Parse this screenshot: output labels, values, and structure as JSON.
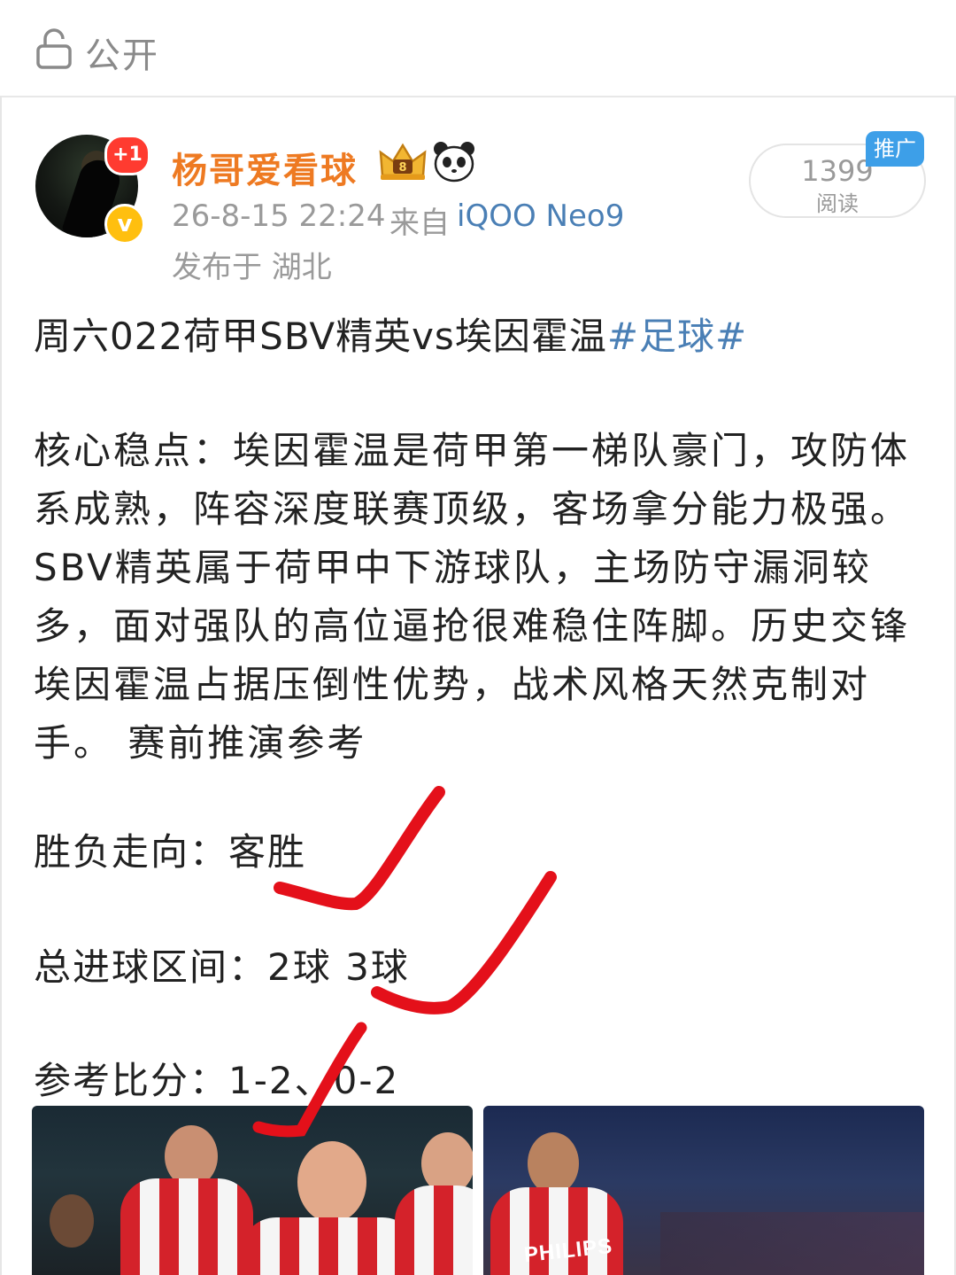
{
  "header_bar": {
    "privacy_label": "公开",
    "lock_icon": "lock-open-icon"
  },
  "post": {
    "author": {
      "name": "杨哥爱看球",
      "plus_badge": "+1",
      "verified_mark": "v",
      "crown_icon": "crown-vip-icon",
      "panda_icon": "panda-icon"
    },
    "timestamp": "26-8-15 22:24",
    "source_prefix": "来自",
    "source_device": "iQOO Neo9",
    "location": "发布于 湖北",
    "reads": {
      "count": "1399",
      "label": "阅读"
    },
    "promo_tag": "推广",
    "title_text": "周六022荷甲SBV精英vs埃因霍温",
    "hashtag": "#足球#",
    "analysis": "核心稳点：埃因霍温是荷甲第一梯队豪门，攻防体系成熟，阵容深度联赛顶级，客场拿分能力极强。SBV精英属于荷甲中下游球队，主场防守漏洞较多，面对强队的高位逼抢很难稳住阵脚。历史交锋埃因霍温占据压倒性优势，战术风格天然克制对手。 赛前推演参考",
    "result_line": "胜负走向：客胜",
    "goals_line": "总进球区间：2球  3球",
    "score_line": "参考比分：1-2、0-2",
    "image_2_caption": "PHILIPS"
  },
  "colors": {
    "username": "#ee7a22",
    "link": "#4a7fb5",
    "promo_tag": "#3d9fe8",
    "annotation": "#e4101a"
  }
}
